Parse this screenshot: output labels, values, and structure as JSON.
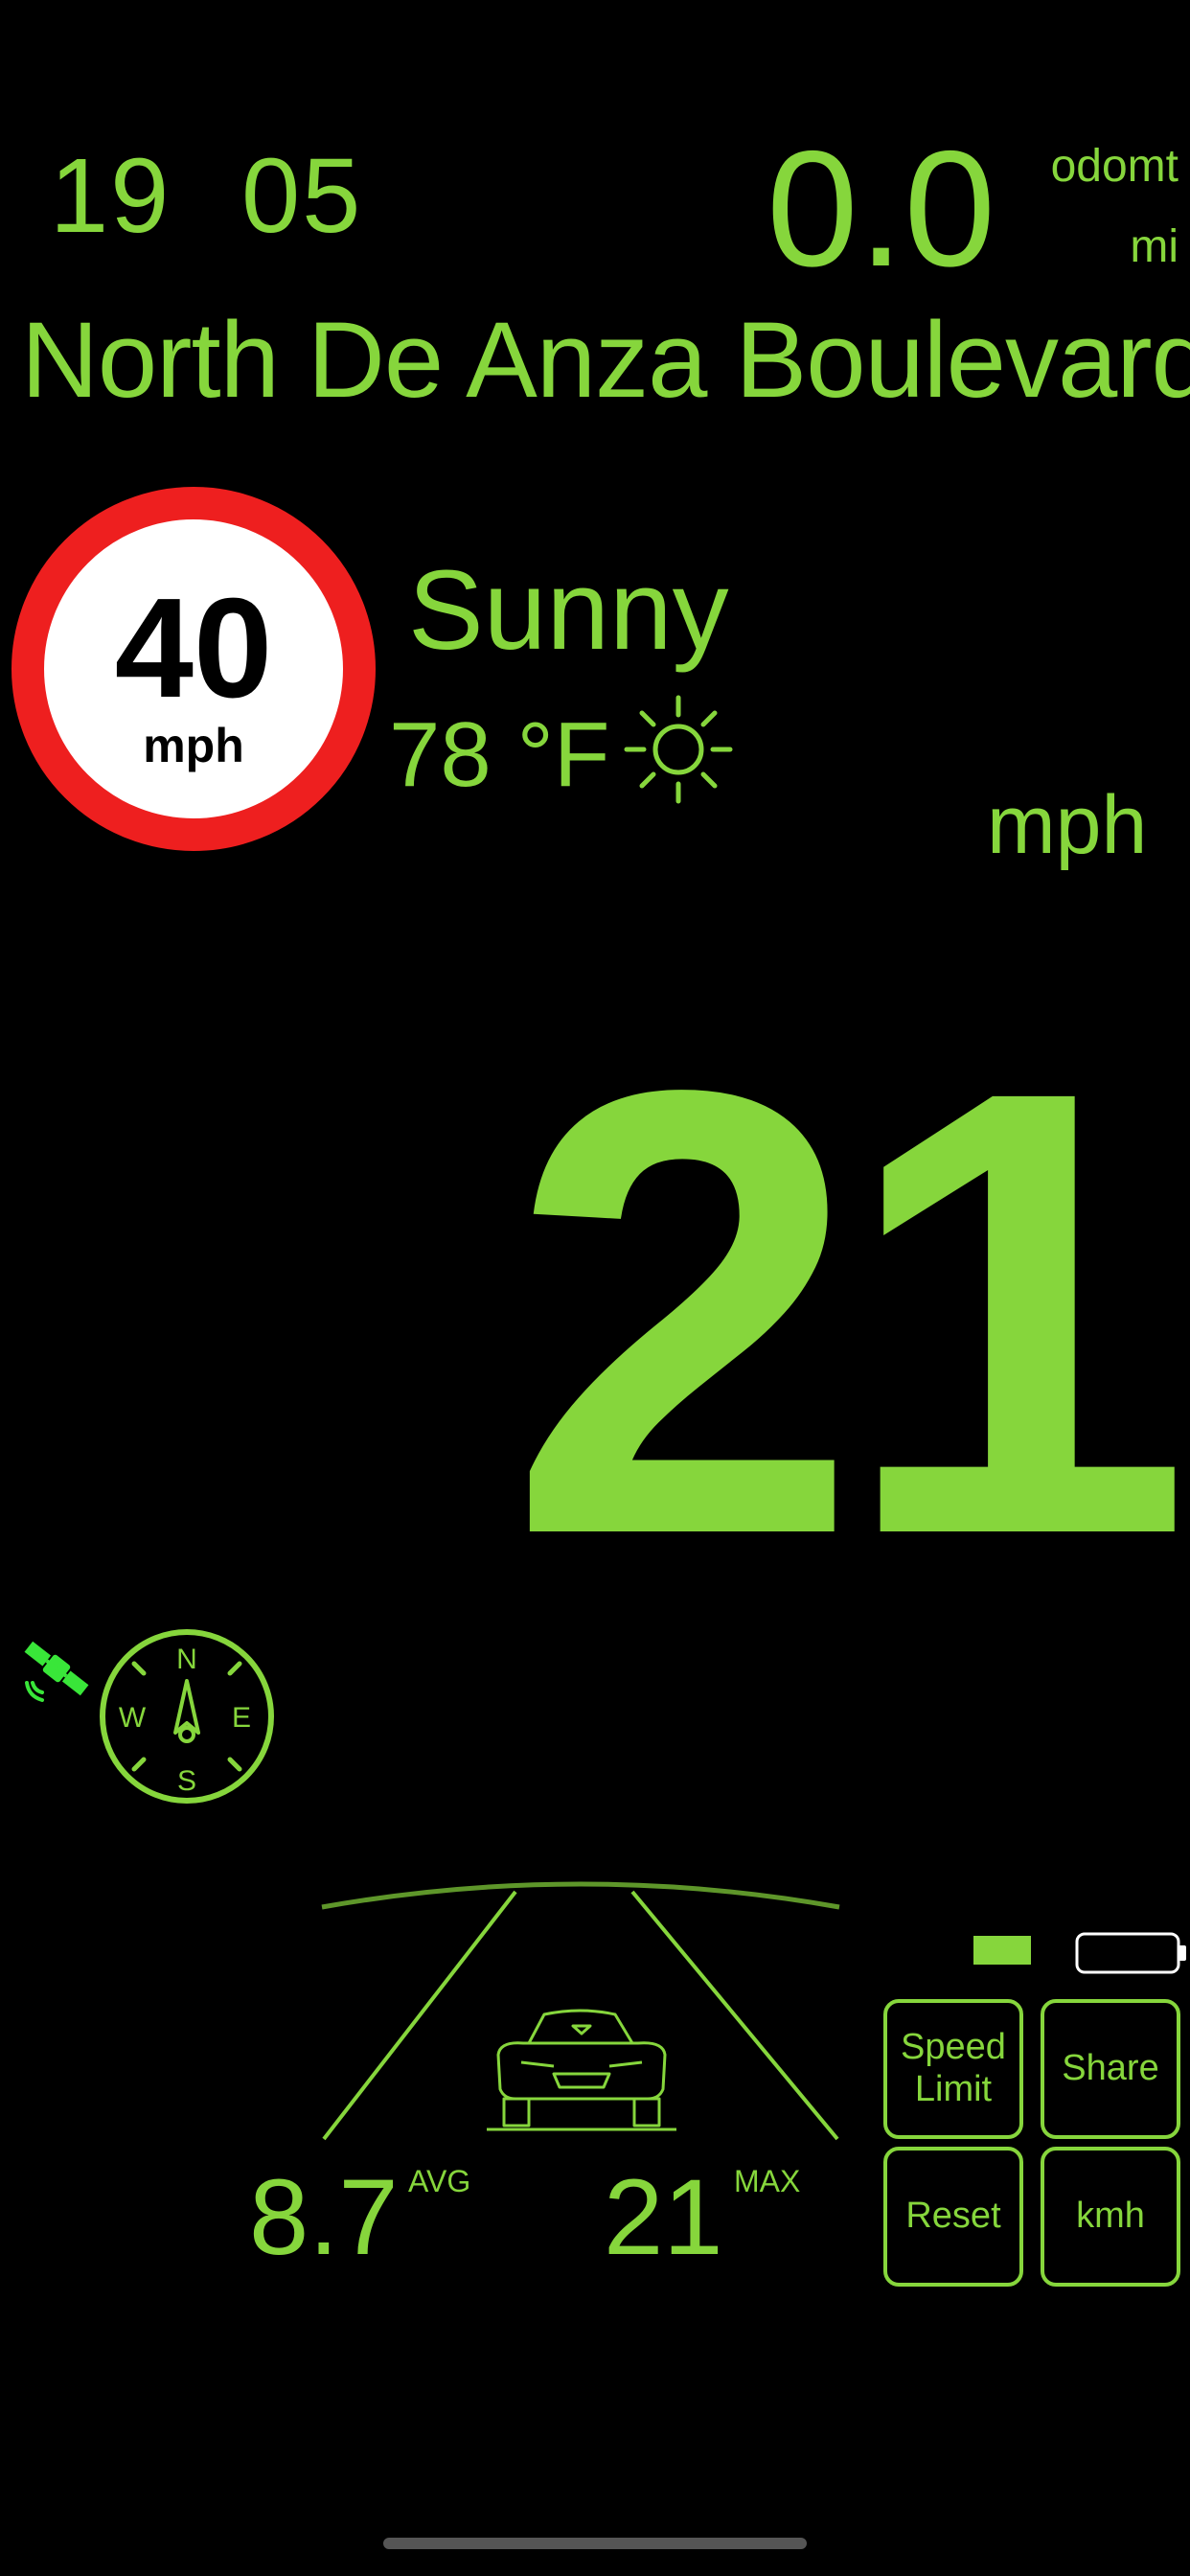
{
  "clock": {
    "hour": "19",
    "minute": "05"
  },
  "odometer": {
    "value": "0.0",
    "label": "odomt",
    "unit": "mi"
  },
  "street": {
    "name": "North De Anza Boulevard"
  },
  "speed_limit": {
    "value": "40",
    "unit": "mph",
    "colors": {
      "ring": "#ee1f1f",
      "face": "#ffffff"
    }
  },
  "weather": {
    "condition": "Sunny",
    "temperature": "78 °F",
    "icon": "sun-icon"
  },
  "speed": {
    "value": "21",
    "unit": "mph"
  },
  "stats": {
    "avg_value": "8.7",
    "avg_label": "AVG",
    "max_value": "21",
    "max_label": "MAX"
  },
  "compass": {
    "n": "N",
    "s": "S",
    "e": "E",
    "w": "W"
  },
  "icons": {
    "gps": "satellite-icon",
    "compass": "compass-icon",
    "car": "car-icon",
    "battery": "battery-icon"
  },
  "battery": {
    "level": 0.4
  },
  "buttons": {
    "speed_limit_line1": "Speed",
    "speed_limit_line2": "Limit",
    "share": "Share",
    "reset": "Reset",
    "unit": "kmh"
  },
  "colors": {
    "accent": "#86d63c",
    "background": "#000000",
    "gps": "#39e639"
  }
}
